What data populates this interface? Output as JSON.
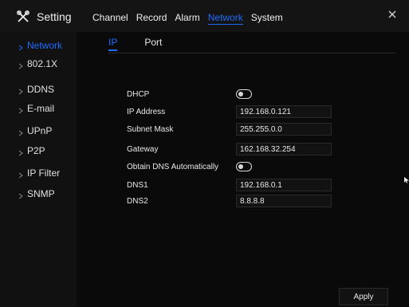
{
  "window": {
    "title": "Setting",
    "tabs": [
      "Channel",
      "Record",
      "Alarm",
      "Network",
      "System"
    ],
    "active_tab": "Network",
    "close_icon": "close-icon",
    "title_icon": "settings-tool-icon"
  },
  "sidebar": {
    "items": [
      "Network",
      "802.1X",
      "DDNS",
      "E-mail",
      "UPnP",
      "P2P",
      "IP Filter",
      "SNMP"
    ],
    "active_item": "Network"
  },
  "subtabs": {
    "items": [
      "IP",
      "Port"
    ],
    "active": "IP"
  },
  "network": {
    "dhcp_label": "DHCP",
    "dhcp_enabled": false,
    "ip_address_label": "IP Address",
    "ip_address": "192.168.0.121",
    "subnet_mask_label": "Subnet Mask",
    "subnet_mask": "255.255.0.0",
    "gateway_label": "Gateway",
    "gateway": "162.168.32.254",
    "obtain_dns_label": "Obtain DNS Automatically",
    "obtain_dns_enabled": false,
    "dns1_label": "DNS1",
    "dns1": "192.168.0.1",
    "dns2_label": "DNS2",
    "dns2": "8.8.8.8"
  },
  "actions": {
    "apply_label": "Apply"
  },
  "colors": {
    "accent": "#1f6bff",
    "background": "#0a0a0a",
    "sidebar": "#111111",
    "text": "#e8e8e8",
    "field_bg": "#121212",
    "field_border": "#2a2a2a"
  }
}
